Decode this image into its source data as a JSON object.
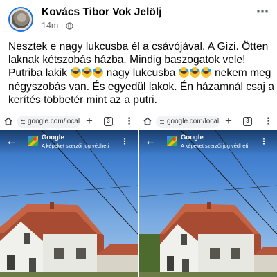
{
  "post": {
    "author": "Kovács Tibor Vok Jelölj",
    "time": "14m",
    "separator": "·",
    "more": "⋯",
    "text": {
      "p1": "Nesztek e nagy lukcusba él a csávójával. A Gizi. Ötten laknak kétszobás házba. Mindig baszogatok vele! Putriba lakik ",
      "p2": " nagy lukcusba ",
      "p3": " nekem meg négyszobás van. És egyedül lakok. Én házamnál csaj a kerítés többetér mint az a putri."
    },
    "emoji_name": "face-with-tears-of-joy-icon"
  },
  "screenshots": [
    {
      "url": "google.com/local",
      "tab_count": "3",
      "plus": "+",
      "menu": "⋮",
      "maps_title": "Google",
      "maps_subtitle": "A képeket szerzői jog védheti",
      "back": "←"
    },
    {
      "url": "google.com/local",
      "tab_count": "3",
      "plus": "+",
      "menu": "⋮",
      "maps_title": "Google",
      "maps_subtitle": "A képeket szerzői jog védheti",
      "back": "←"
    }
  ],
  "colors": {
    "link_blue": "#1b74e4",
    "text": "#050505",
    "meta": "#65676b",
    "roof": "#b5553a",
    "sky": "#4b88d4"
  }
}
